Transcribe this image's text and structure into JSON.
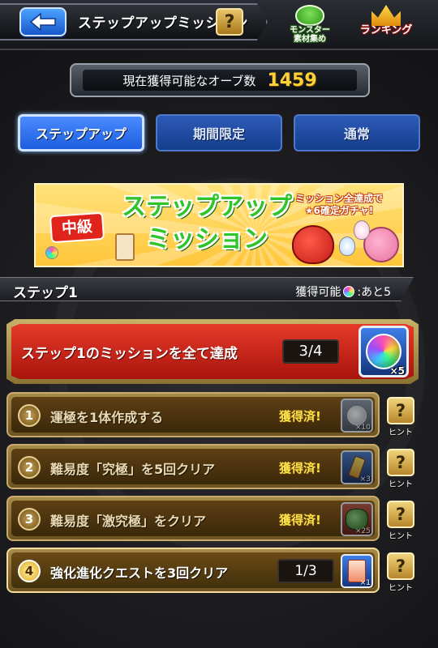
{
  "header": {
    "title": "ステップアップミッション",
    "help_label": "?",
    "icons": [
      {
        "name": "monster-material-icon",
        "label_line1": "モンスター",
        "label_line2": "素材集め"
      },
      {
        "name": "ranking-icon",
        "label_line1": "ランキング",
        "label_line2": ""
      }
    ]
  },
  "orbs": {
    "label": "現在獲得可能なオーブ数",
    "count": "1459"
  },
  "tabs": [
    {
      "label": "ステップアップ",
      "active": true
    },
    {
      "label": "期間限定",
      "active": false
    },
    {
      "label": "通常",
      "active": false
    }
  ],
  "banner": {
    "level": "中級",
    "title_line1": "ステップアップ",
    "title_line2": "ミッション",
    "sub_line1": "ミッション全達成で",
    "sub_line2": "★6確定ガチャ!"
  },
  "step": {
    "title": "ステップ1",
    "remain_label": "獲得可能",
    "remain_value": ":あと5"
  },
  "main_mission": {
    "text": "ステップ1のミッションを全て達成",
    "progress": "3/4",
    "reward_icon": "orb-icon",
    "reward_qty": "×5"
  },
  "missions": [
    {
      "num": "1",
      "text": "運極を1体作成する",
      "status": "獲得済!",
      "reward_icon": "medal-icon",
      "reward_qty": "×10"
    },
    {
      "num": "2",
      "text": "難易度「究極」を5回クリア",
      "status": "獲得済!",
      "reward_icon": "drink-icon",
      "reward_qty": "×3"
    },
    {
      "num": "3",
      "text": "難易度「激究極」をクリア",
      "status": "獲得済!",
      "reward_icon": "monster-icon",
      "reward_qty": "×25"
    },
    {
      "num": "4",
      "text": "強化進化クエストを3回クリア",
      "progress": "1/3",
      "reward_icon": "scroll-icon",
      "reward_qty": "×1"
    }
  ],
  "hint_label": "ヒント",
  "hint_symbol": "?",
  "colors": {
    "accent_blue": "#1d5de0",
    "mission_red": "#e63a2a",
    "orb_count_yellow": "#ffd23a"
  }
}
